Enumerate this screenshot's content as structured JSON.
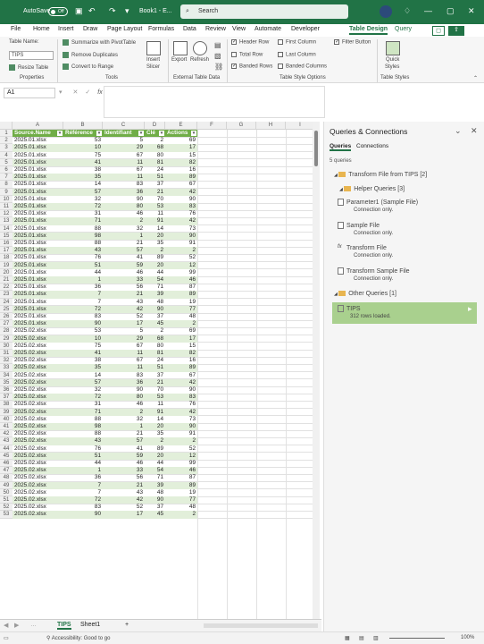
{
  "titlebar": {
    "autosave": "AutoSave",
    "toggle": "Off",
    "book": "Book1 - E...",
    "search_placeholder": "Search",
    "icons": [
      "save-icon",
      "undo-icon",
      "redo-icon",
      "quick-access-icon"
    ]
  },
  "tabs": [
    "File",
    "Home",
    "Insert",
    "Draw",
    "Page Layout",
    "Formulas",
    "Data",
    "Review",
    "View",
    "Automate",
    "Developer",
    "Table Design",
    "Query"
  ],
  "active_tab": "Table Design",
  "ribbon": {
    "table_name_label": "Table Name:",
    "table_name_value": "TIPS",
    "resize_table": "Resize Table",
    "properties": "Properties",
    "summarize": "Summarize with PivotTable",
    "remove_dup": "Remove Duplicates",
    "convert": "Convert to Range",
    "tools": "Tools",
    "insert_slicer_1": "Insert",
    "insert_slicer_2": "Slicer",
    "export": "Export",
    "refresh": "Refresh",
    "external": "External Table Data",
    "header_row": "Header Row",
    "total_row": "Total Row",
    "banded_rows": "Banded Rows",
    "first_col": "First Column",
    "last_col": "Last Column",
    "banded_cols": "Banded Columns",
    "filter_btn": "Filter Button",
    "style_options": "Table Style Options",
    "quick_styles_1": "Quick",
    "quick_styles_2": "Styles",
    "table_styles": "Table Styles"
  },
  "namebox": "A1",
  "fx": "fx",
  "columns": [
    "A",
    "B",
    "C",
    "D",
    "E",
    "F",
    "G",
    "H",
    "I"
  ],
  "headers": [
    "Source.Name",
    "Référence",
    "Identifiant",
    "Clé",
    "Actions"
  ],
  "rows": [
    [
      "2025.01.xlsx",
      53,
      5,
      2,
      69
    ],
    [
      "2025.01.xlsx",
      10,
      29,
      68,
      17
    ],
    [
      "2025.01.xlsx",
      75,
      67,
      80,
      15
    ],
    [
      "2025.01.xlsx",
      41,
      11,
      81,
      82
    ],
    [
      "2025.01.xlsx",
      38,
      67,
      24,
      16
    ],
    [
      "2025.01.xlsx",
      35,
      11,
      51,
      89
    ],
    [
      "2025.01.xlsx",
      14,
      83,
      37,
      67
    ],
    [
      "2025.01.xlsx",
      57,
      36,
      21,
      42
    ],
    [
      "2025.01.xlsx",
      32,
      90,
      70,
      90
    ],
    [
      "2025.01.xlsx",
      72,
      80,
      53,
      83
    ],
    [
      "2025.01.xlsx",
      31,
      46,
      11,
      76
    ],
    [
      "2025.01.xlsx",
      71,
      2,
      91,
      42
    ],
    [
      "2025.01.xlsx",
      88,
      32,
      14,
      73
    ],
    [
      "2025.01.xlsx",
      98,
      1,
      20,
      90
    ],
    [
      "2025.01.xlsx",
      88,
      21,
      35,
      91
    ],
    [
      "2025.01.xlsx",
      43,
      57,
      2,
      2
    ],
    [
      "2025.01.xlsx",
      76,
      41,
      89,
      52
    ],
    [
      "2025.01.xlsx",
      51,
      59,
      20,
      12
    ],
    [
      "2025.01.xlsx",
      44,
      46,
      44,
      99
    ],
    [
      "2025.01.xlsx",
      1,
      33,
      54,
      46
    ],
    [
      "2025.01.xlsx",
      36,
      56,
      71,
      87
    ],
    [
      "2025.01.xlsx",
      7,
      21,
      39,
      89
    ],
    [
      "2025.01.xlsx",
      7,
      43,
      48,
      19
    ],
    [
      "2025.01.xlsx",
      72,
      42,
      90,
      77
    ],
    [
      "2025.01.xlsx",
      83,
      52,
      37,
      48
    ],
    [
      "2025.01.xlsx",
      90,
      17,
      45,
      2
    ],
    [
      "2025.02.xlsx",
      53,
      5,
      2,
      69
    ],
    [
      "2025.02.xlsx",
      10,
      29,
      68,
      17
    ],
    [
      "2025.02.xlsx",
      75,
      67,
      80,
      15
    ],
    [
      "2025.02.xlsx",
      41,
      11,
      81,
      82
    ],
    [
      "2025.02.xlsx",
      38,
      67,
      24,
      16
    ],
    [
      "2025.02.xlsx",
      35,
      11,
      51,
      89
    ],
    [
      "2025.02.xlsx",
      14,
      83,
      37,
      67
    ],
    [
      "2025.02.xlsx",
      57,
      36,
      21,
      42
    ],
    [
      "2025.02.xlsx",
      32,
      90,
      70,
      90
    ],
    [
      "2025.02.xlsx",
      72,
      80,
      53,
      83
    ],
    [
      "2025.02.xlsx",
      31,
      46,
      11,
      76
    ],
    [
      "2025.02.xlsx",
      71,
      2,
      91,
      42
    ],
    [
      "2025.02.xlsx",
      88,
      32,
      14,
      73
    ],
    [
      "2025.02.xlsx",
      98,
      1,
      20,
      90
    ],
    [
      "2025.02.xlsx",
      88,
      21,
      35,
      91
    ],
    [
      "2025.02.xlsx",
      43,
      57,
      2,
      2
    ],
    [
      "2025.02.xlsx",
      76,
      41,
      89,
      52
    ],
    [
      "2025.02.xlsx",
      51,
      59,
      20,
      12
    ],
    [
      "2025.02.xlsx",
      44,
      46,
      44,
      99
    ],
    [
      "2025.02.xlsx",
      1,
      33,
      54,
      46
    ],
    [
      "2025.02.xlsx",
      36,
      56,
      71,
      87
    ],
    [
      "2025.02.xlsx",
      7,
      21,
      39,
      89
    ],
    [
      "2025.02.xlsx",
      7,
      43,
      48,
      19
    ],
    [
      "2025.02.xlsx",
      72,
      42,
      90,
      77
    ],
    [
      "2025.02.xlsx",
      83,
      52,
      37,
      48
    ],
    [
      "2025.02.xlsx",
      90,
      17,
      45,
      2
    ]
  ],
  "sheets": [
    "TIPS",
    "Sheet1"
  ],
  "active_sheet": "TIPS",
  "status": {
    "accessibility": "Accessibility: Good to go",
    "zoom": "100%"
  },
  "panel": {
    "title": "Queries & Connections",
    "tab_queries": "Queries",
    "tab_connections": "Connections",
    "count": "5 queries",
    "items": [
      {
        "label": "Transform File from TIPS [2]",
        "sub": "",
        "type": "folder"
      },
      {
        "label": "Helper Queries [3]",
        "sub": "",
        "type": "folder"
      },
      {
        "label": "Parameter1 (Sample File)",
        "sub": "Connection only.",
        "type": "query"
      },
      {
        "label": "Sample File",
        "sub": "Connection only.",
        "type": "query"
      },
      {
        "label": "Transform File",
        "sub": "Connection only.",
        "type": "function"
      },
      {
        "label": "Transform Sample File",
        "sub": "Connection only.",
        "type": "query"
      },
      {
        "label": "Other Queries [1]",
        "sub": "",
        "type": "folder"
      }
    ],
    "tips_label": "TIPS",
    "tips_sub": "312 rows loaded."
  },
  "colors": {
    "accent": "#217346",
    "header_green": "#70ad47",
    "band": "#e2efda"
  }
}
